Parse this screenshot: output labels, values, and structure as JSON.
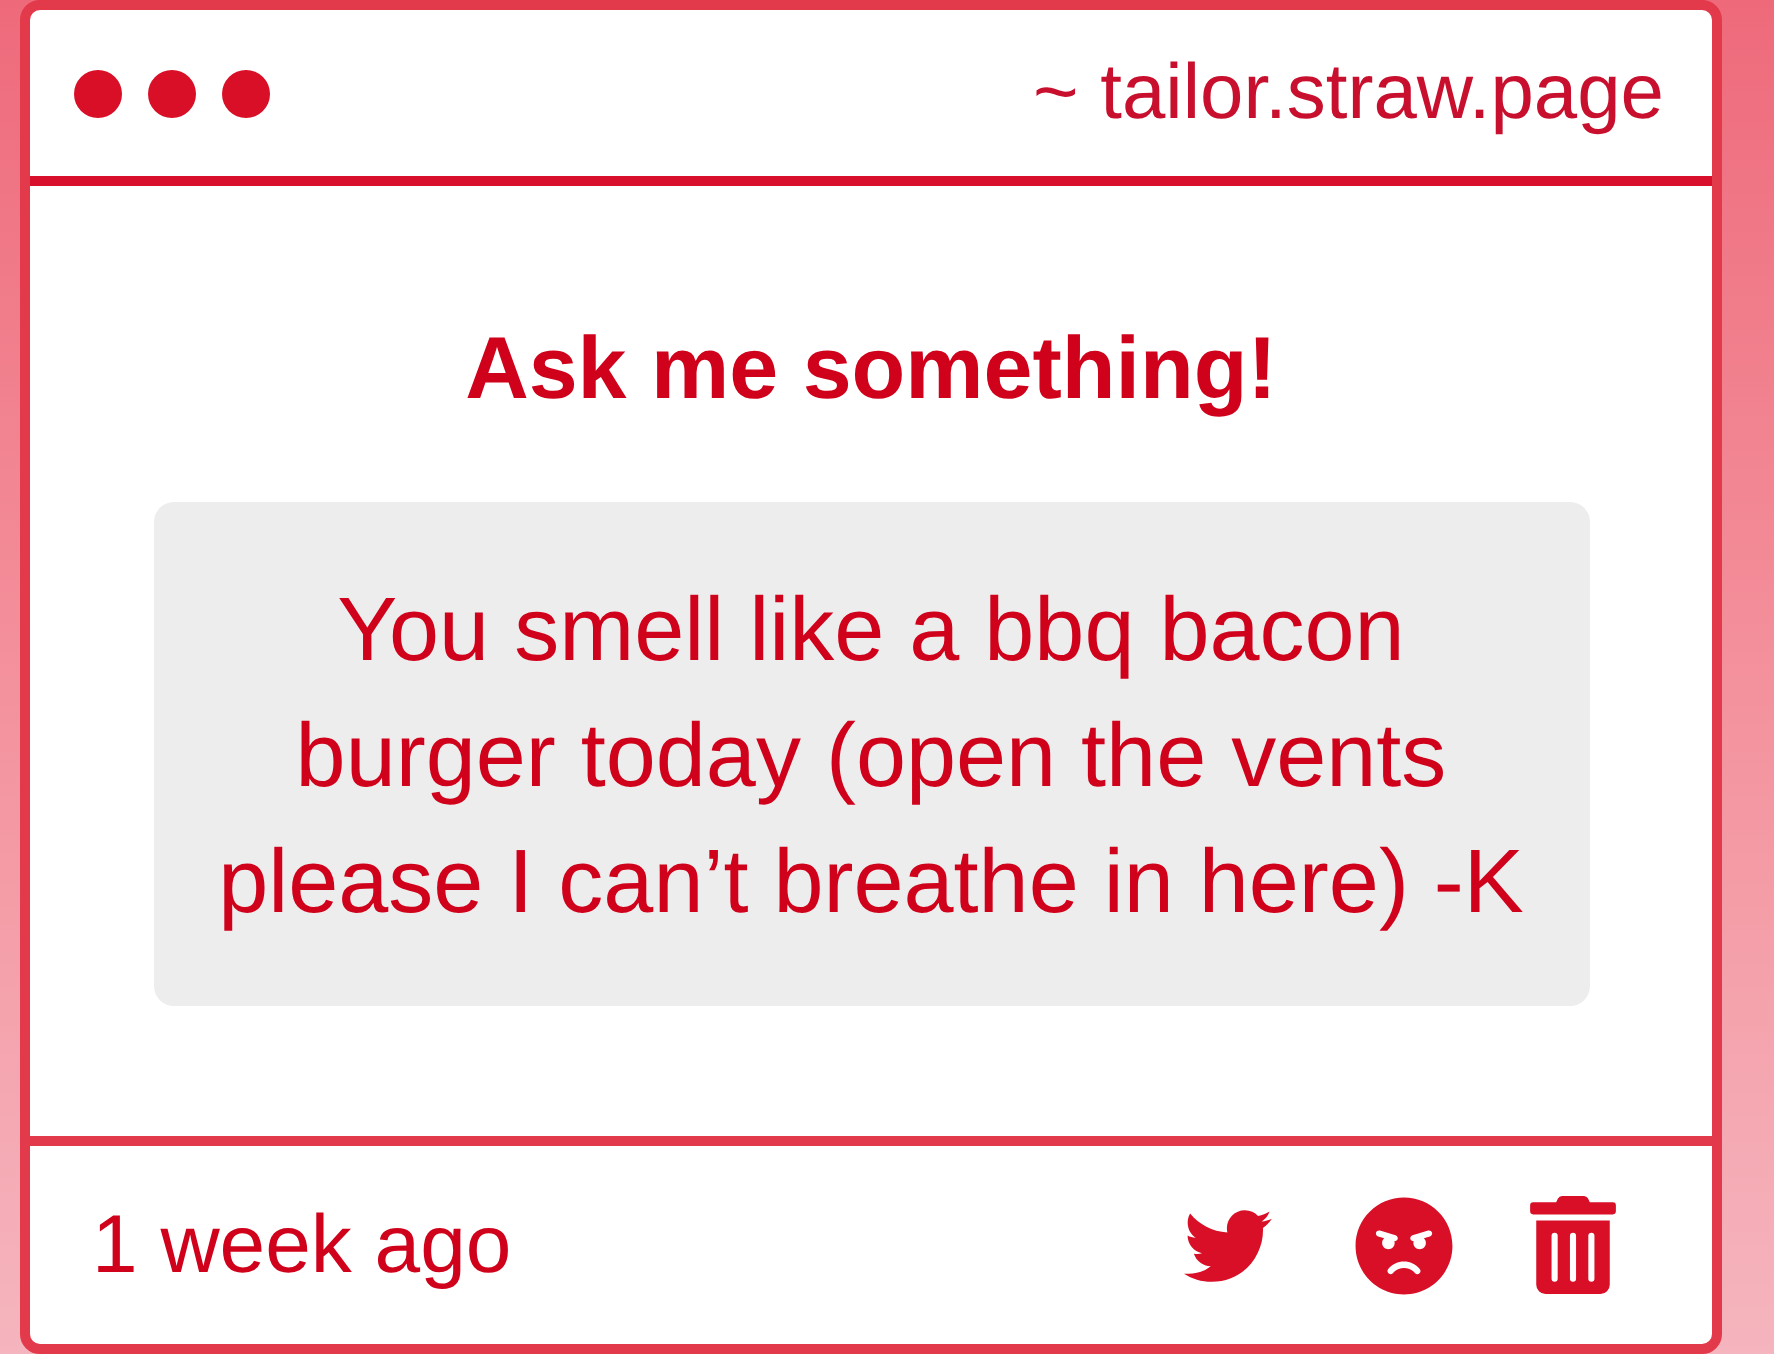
{
  "window": {
    "address": "~ tailor.straw.page"
  },
  "card": {
    "title": "Ask me something!",
    "question_lines": [
      "You smell like a bbq bacon",
      "burger today (open the vents",
      "please I can’t breathe in here) -K"
    ]
  },
  "footer": {
    "time": "1 week ago",
    "actions": [
      {
        "kind": "bird"
      },
      {
        "kind": "angry"
      },
      {
        "kind": "trash"
      }
    ]
  }
}
